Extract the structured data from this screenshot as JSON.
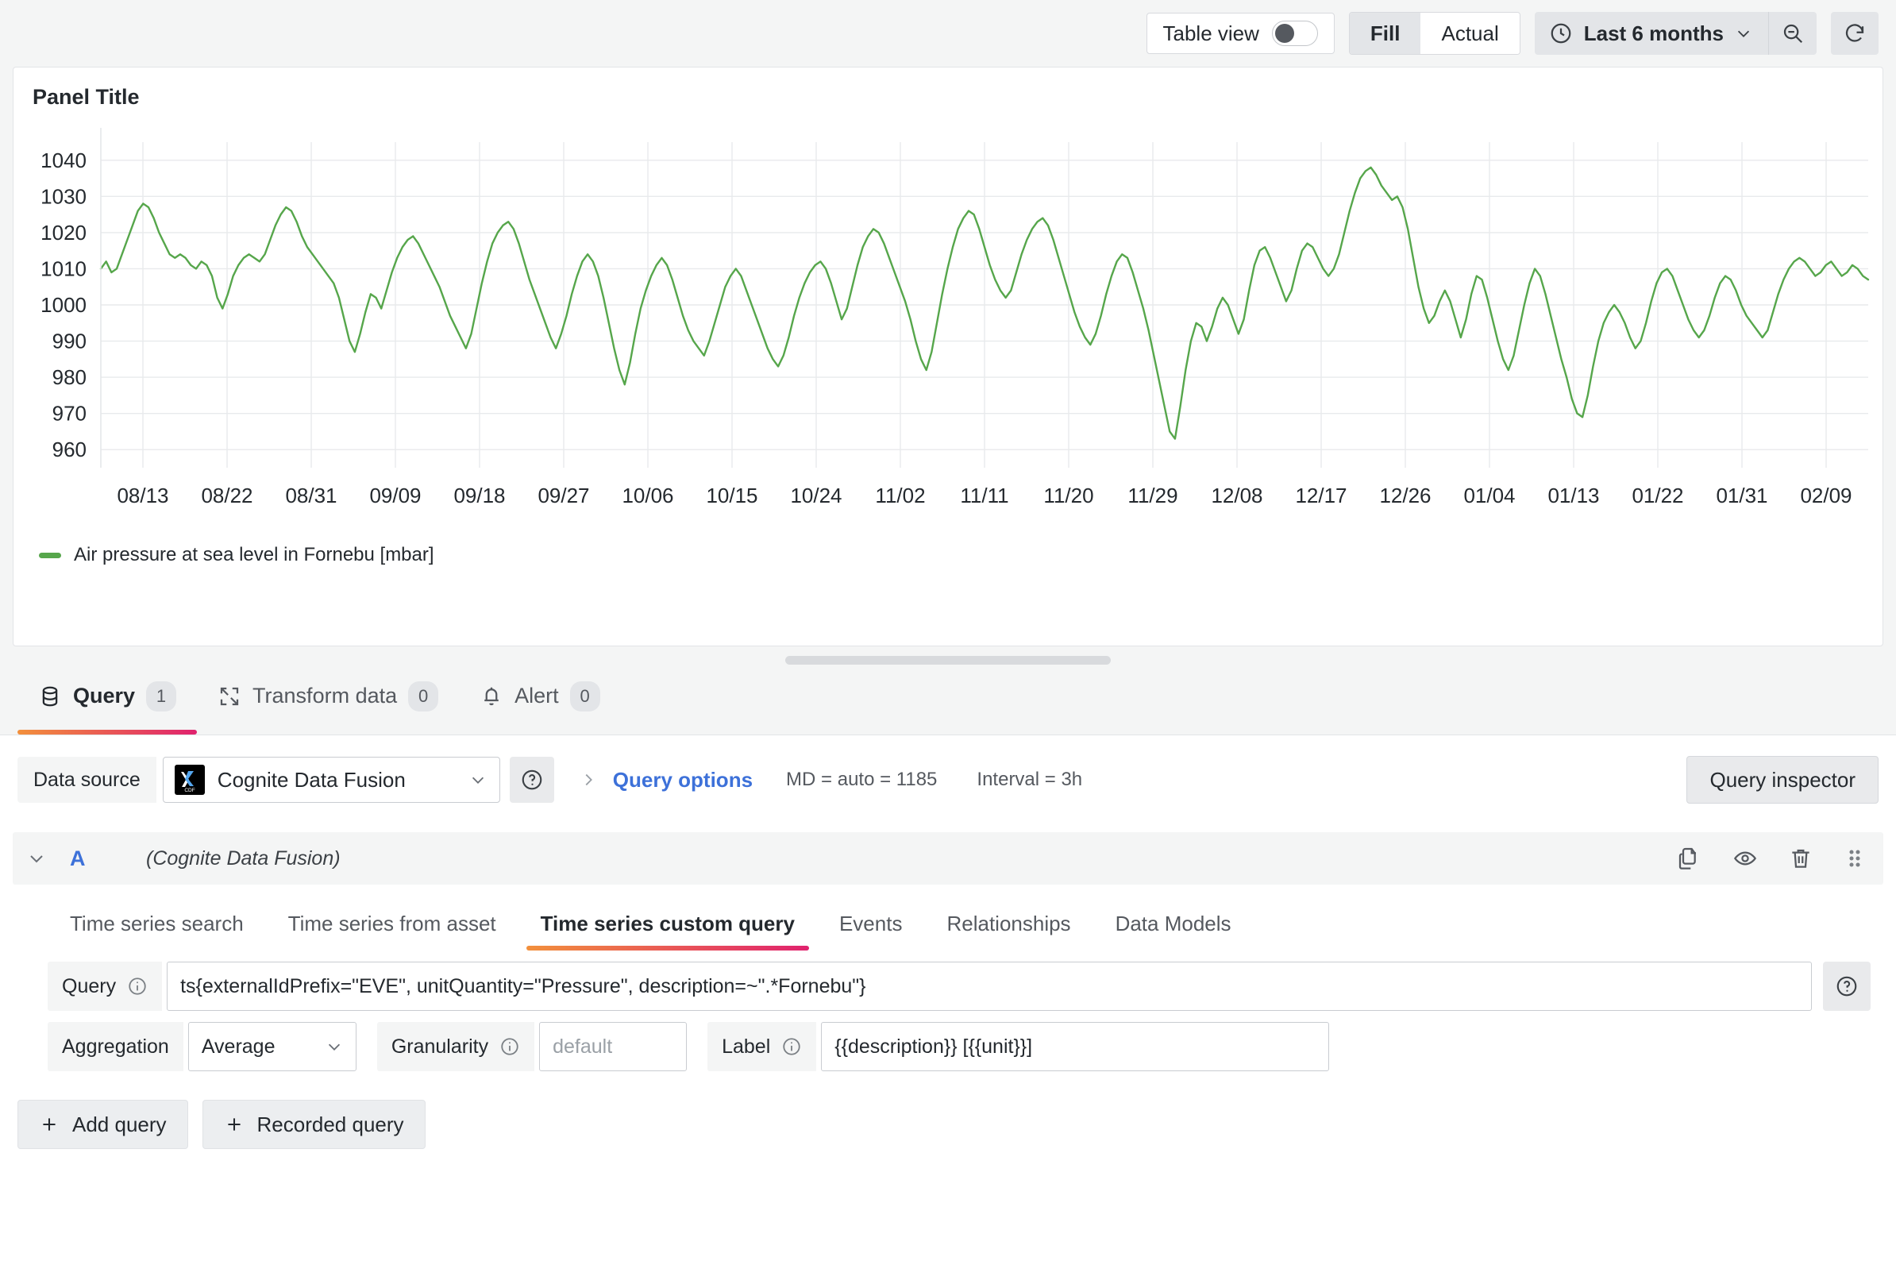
{
  "toolbar": {
    "table_view_label": "Table view",
    "table_view_on": false,
    "fill_label": "Fill",
    "actual_label": "Actual",
    "time_range": "Last 6 months",
    "clock_icon": "clock-icon",
    "zoom_out_icon": "zoom-out-icon",
    "refresh_icon": "refresh-icon"
  },
  "panel": {
    "title": "Panel Title",
    "legend_label": "Air pressure at sea level in Fornebu [mbar]",
    "series_color": "#56a64b"
  },
  "chart_data": {
    "type": "line",
    "title": "Panel Title",
    "xlabel": "",
    "ylabel": "",
    "ylim": [
      955,
      1045
    ],
    "yticks": [
      1040,
      1030,
      1020,
      1010,
      1000,
      990,
      980,
      970,
      960
    ],
    "grid": true,
    "legend_position": "bottom-left",
    "xticks": [
      "08/13",
      "08/22",
      "08/31",
      "09/09",
      "09/18",
      "09/27",
      "10/06",
      "10/15",
      "10/24",
      "11/02",
      "11/11",
      "11/20",
      "11/29",
      "12/08",
      "12/17",
      "12/26",
      "01/04",
      "01/13",
      "01/22",
      "01/31",
      "02/09"
    ],
    "series": [
      {
        "name": "Air pressure at sea level in Fornebu [mbar]",
        "color": "#56a64b",
        "unit": "mbar",
        "values": [
          1010,
          1012,
          1009,
          1010,
          1014,
          1018,
          1022,
          1026,
          1028,
          1027,
          1024,
          1020,
          1017,
          1014,
          1013,
          1014,
          1013,
          1011,
          1010,
          1012,
          1011,
          1008,
          1002,
          999,
          1003,
          1008,
          1011,
          1013,
          1014,
          1013,
          1012,
          1014,
          1018,
          1022,
          1025,
          1027,
          1026,
          1023,
          1019,
          1016,
          1014,
          1012,
          1010,
          1008,
          1006,
          1002,
          996,
          990,
          987,
          992,
          998,
          1003,
          1002,
          999,
          1004,
          1009,
          1013,
          1016,
          1018,
          1019,
          1017,
          1014,
          1011,
          1008,
          1005,
          1001,
          997,
          994,
          991,
          988,
          992,
          999,
          1006,
          1012,
          1017,
          1020,
          1022,
          1023,
          1021,
          1017,
          1012,
          1007,
          1003,
          999,
          995,
          991,
          988,
          992,
          997,
          1003,
          1008,
          1012,
          1014,
          1012,
          1008,
          1002,
          995,
          988,
          982,
          978,
          984,
          992,
          999,
          1004,
          1008,
          1011,
          1013,
          1011,
          1007,
          1002,
          997,
          993,
          990,
          988,
          986,
          990,
          995,
          1000,
          1005,
          1008,
          1010,
          1008,
          1004,
          1000,
          996,
          992,
          988,
          985,
          983,
          986,
          991,
          997,
          1002,
          1006,
          1009,
          1011,
          1012,
          1010,
          1006,
          1001,
          996,
          999,
          1005,
          1011,
          1016,
          1019,
          1021,
          1020,
          1017,
          1013,
          1009,
          1005,
          1001,
          996,
          990,
          985,
          982,
          987,
          995,
          1003,
          1010,
          1016,
          1021,
          1024,
          1026,
          1025,
          1021,
          1016,
          1011,
          1007,
          1004,
          1002,
          1004,
          1009,
          1014,
          1018,
          1021,
          1023,
          1024,
          1022,
          1018,
          1013,
          1008,
          1003,
          998,
          994,
          991,
          989,
          992,
          997,
          1003,
          1008,
          1012,
          1014,
          1013,
          1009,
          1004,
          999,
          993,
          986,
          979,
          972,
          965,
          963,
          972,
          982,
          990,
          995,
          994,
          990,
          994,
          999,
          1002,
          1000,
          996,
          992,
          996,
          1004,
          1011,
          1015,
          1016,
          1013,
          1009,
          1005,
          1001,
          1004,
          1010,
          1015,
          1017,
          1016,
          1013,
          1010,
          1008,
          1010,
          1014,
          1020,
          1026,
          1031,
          1035,
          1037,
          1038,
          1036,
          1033,
          1031,
          1029,
          1030,
          1027,
          1021,
          1013,
          1005,
          999,
          995,
          997,
          1001,
          1004,
          1001,
          996,
          991,
          996,
          1003,
          1008,
          1007,
          1002,
          996,
          990,
          985,
          982,
          986,
          993,
          1000,
          1006,
          1010,
          1008,
          1003,
          997,
          991,
          985,
          980,
          974,
          970,
          969,
          975,
          983,
          990,
          995,
          998,
          1000,
          998,
          995,
          991,
          988,
          990,
          995,
          1001,
          1006,
          1009,
          1010,
          1008,
          1004,
          1000,
          996,
          993,
          991,
          993,
          997,
          1002,
          1006,
          1008,
          1007,
          1004,
          1000,
          997,
          995,
          993,
          991,
          993,
          998,
          1003,
          1007,
          1010,
          1012,
          1013,
          1012,
          1010,
          1008,
          1009,
          1011,
          1012,
          1010,
          1008,
          1009,
          1011,
          1010,
          1008,
          1007
        ]
      }
    ]
  },
  "tabs": [
    {
      "label": "Query",
      "count": "1",
      "icon": "database-icon",
      "active": true
    },
    {
      "label": "Transform data",
      "count": "0",
      "icon": "transform-icon",
      "active": false
    },
    {
      "label": "Alert",
      "count": "0",
      "icon": "bell-icon",
      "active": false
    }
  ],
  "datasource": {
    "label": "Data source",
    "selected": "Cognite Data Fusion",
    "logo_text": "CDF",
    "help_icon": "help-circle-icon",
    "expand_icon": "chevron-right-icon",
    "query_options_label": "Query options",
    "max_data_points": "MD = auto = 1185",
    "interval": "Interval = 3h",
    "inspector_label": "Query inspector"
  },
  "query_row": {
    "ref_id": "A",
    "datasource_name": "(Cognite Data Fusion)",
    "collapse_icon": "chevron-down-icon",
    "actions": [
      {
        "name": "duplicate-query-icon"
      },
      {
        "name": "hide-response-icon"
      },
      {
        "name": "remove-query-icon"
      },
      {
        "name": "drag-handle-icon"
      }
    ],
    "subtabs": [
      {
        "label": "Time series search",
        "active": false
      },
      {
        "label": "Time series from asset",
        "active": false
      },
      {
        "label": "Time series custom query",
        "active": true
      },
      {
        "label": "Events",
        "active": false
      },
      {
        "label": "Relationships",
        "active": false
      },
      {
        "label": "Data Models",
        "active": false
      }
    ],
    "fields": {
      "query_label": "Query",
      "query_value": "ts{externalIdPrefix=\"EVE\", unitQuantity=\"Pressure\", description=~\".*Fornebu\"}",
      "query_help_icon": "info-circle-icon",
      "query_docs_icon": "help-circle-icon",
      "aggregation_label": "Aggregation",
      "aggregation_value": "Average",
      "granularity_label": "Granularity",
      "granularity_placeholder": "default",
      "granularity_value": "",
      "label_label": "Label",
      "label_value": "{{description}} [{{unit}}]"
    }
  },
  "footer": {
    "add_query_label": "Add query",
    "recorded_query_label": "Recorded query",
    "plus_icon": "plus-icon"
  }
}
